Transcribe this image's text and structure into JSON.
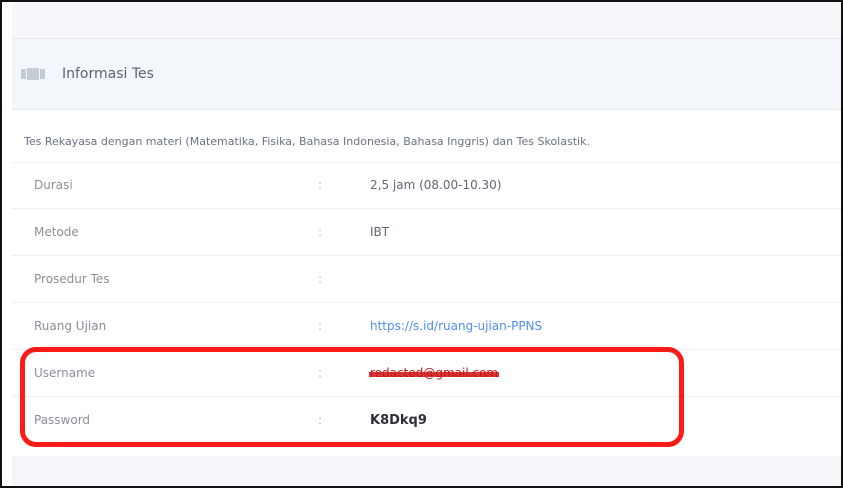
{
  "panel": {
    "title": "Informasi Tes",
    "icon": "video-icon",
    "description": "Tes Rekayasa dengan materi (Matematika, Fisika, Bahasa Indonesia, Bahasa Inggris) dan Tes Skolastik.",
    "separator": ":",
    "rows": [
      {
        "label": "Durasi",
        "value": "2,5 jam (08.00-10.30)"
      },
      {
        "label": "Metode",
        "value": "IBT"
      },
      {
        "label": "Prosedur Tes",
        "value": ""
      },
      {
        "label": "Ruang Ujian",
        "value": "https://s.id/ruang-ujian-PPNS"
      },
      {
        "label": "Username",
        "value": "redacted@gmail.com"
      },
      {
        "label": "Password",
        "value": "K8Dkq9"
      }
    ]
  },
  "colors": {
    "highlight": "#ff1a1a",
    "link": "#4f8ef0",
    "redaction": "#cd1414"
  }
}
